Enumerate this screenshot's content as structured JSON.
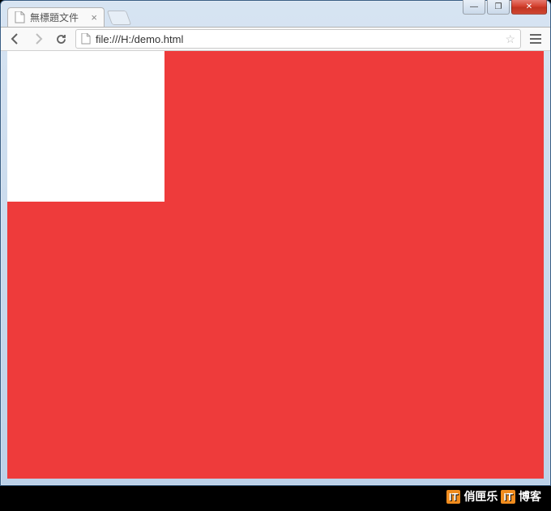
{
  "window": {
    "controls": {
      "minimize": "—",
      "maximize": "❐",
      "close": "✕"
    }
  },
  "tab": {
    "title": "無標題文件",
    "close": "×"
  },
  "address": {
    "url": "file:///H:/demo.html"
  },
  "watermark": {
    "box1": "IT",
    "text1": "俏匣乐",
    "box2": "IT",
    "text2": "博客"
  },
  "colors": {
    "page_bg": "#ee3b3b",
    "box_bg": "#ffffff"
  }
}
